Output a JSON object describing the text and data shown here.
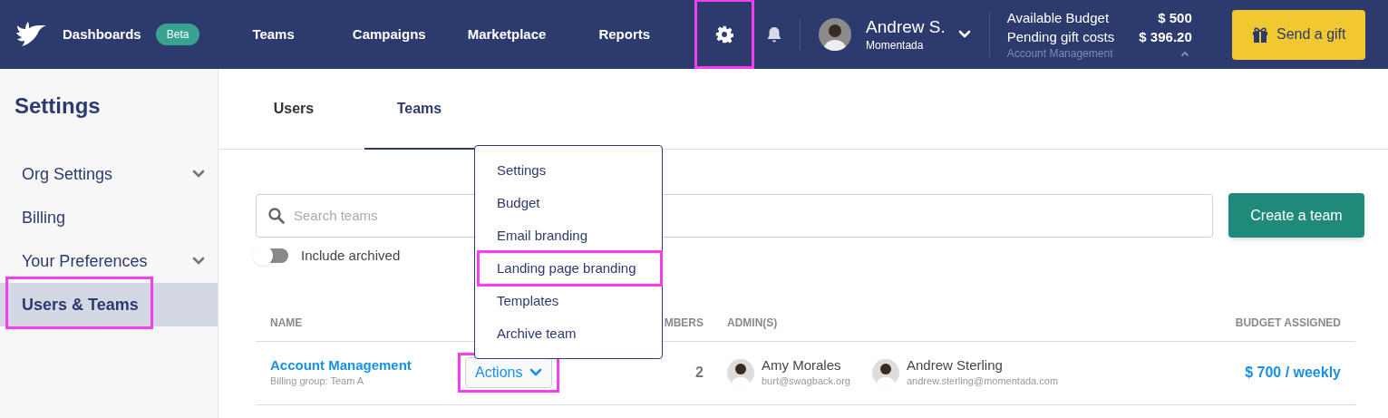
{
  "nav": {
    "brand": "Dashboards",
    "badge": "Beta",
    "links": [
      "Teams",
      "Campaigns",
      "Marketplace",
      "Reports"
    ]
  },
  "settings_button": {
    "highlighted": true
  },
  "user": {
    "name": "Andrew S.",
    "org": "Momentada"
  },
  "budget": {
    "rows": [
      {
        "label": "Available Budget",
        "value": "$ 500"
      },
      {
        "label": "Pending gift costs",
        "value": "$ 396.20"
      }
    ],
    "team": "Account Management"
  },
  "send_button": "Send a gift",
  "sidebar": {
    "title": "Settings",
    "items": [
      {
        "label": "Org Settings",
        "expandable": true,
        "selected": false,
        "highlighted": false
      },
      {
        "label": "Billing",
        "expandable": false,
        "selected": false,
        "highlighted": false
      },
      {
        "label": "Your Preferences",
        "expandable": true,
        "selected": false,
        "highlighted": false
      },
      {
        "label": "Users & Teams",
        "expandable": false,
        "selected": true,
        "highlighted": true
      }
    ]
  },
  "tabs": [
    {
      "label": "Users",
      "selected": false
    },
    {
      "label": "Teams",
      "selected": true
    }
  ],
  "search": {
    "placeholder": "Search teams"
  },
  "create_button": "Create a team",
  "include_archived": {
    "label": "Include archived",
    "on": false
  },
  "table": {
    "columns": [
      "NAME",
      "MBERS",
      "ADMIN(S)",
      "BUDGET ASSIGNED"
    ],
    "rows": [
      {
        "name": "Account Management",
        "billing": "Billing group: Team A",
        "action": {
          "label": "Actions",
          "highlighted": true
        },
        "members": "2",
        "admins": [
          {
            "name": "Amy Morales",
            "email": "burt@swagback.org"
          },
          {
            "name": "Andrew Sterling",
            "email": "andrew.sterling@momentada.com"
          }
        ],
        "budget": "$ 700 / weekly"
      }
    ]
  },
  "menu": {
    "items": [
      {
        "label": "Settings",
        "highlighted": false
      },
      {
        "label": "Budget",
        "highlighted": false
      },
      {
        "label": "Email branding",
        "highlighted": false
      },
      {
        "label": "Landing page branding",
        "highlighted": true
      },
      {
        "label": "Templates",
        "highlighted": false
      },
      {
        "label": "Archive team",
        "highlighted": false
      }
    ]
  }
}
